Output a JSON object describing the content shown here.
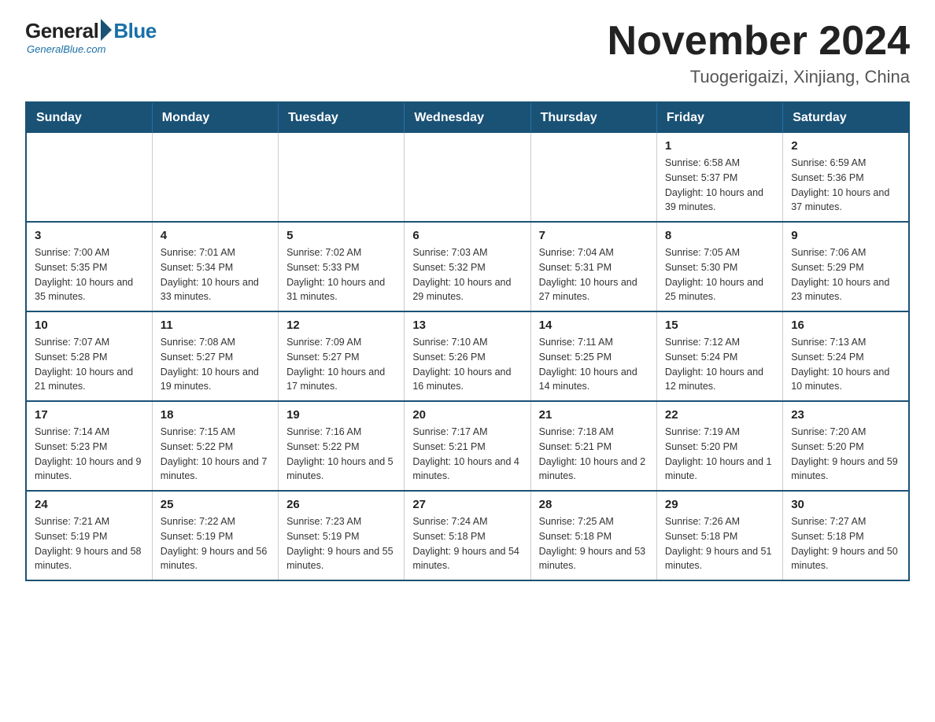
{
  "logo": {
    "general": "General",
    "blue": "Blue",
    "subtitle": "GeneralBlue.com"
  },
  "title": "November 2024",
  "location": "Tuogerigaizi, Xinjiang, China",
  "weekdays": [
    "Sunday",
    "Monday",
    "Tuesday",
    "Wednesday",
    "Thursday",
    "Friday",
    "Saturday"
  ],
  "weeks": [
    [
      {
        "day": "",
        "info": ""
      },
      {
        "day": "",
        "info": ""
      },
      {
        "day": "",
        "info": ""
      },
      {
        "day": "",
        "info": ""
      },
      {
        "day": "",
        "info": ""
      },
      {
        "day": "1",
        "info": "Sunrise: 6:58 AM\nSunset: 5:37 PM\nDaylight: 10 hours and 39 minutes."
      },
      {
        "day": "2",
        "info": "Sunrise: 6:59 AM\nSunset: 5:36 PM\nDaylight: 10 hours and 37 minutes."
      }
    ],
    [
      {
        "day": "3",
        "info": "Sunrise: 7:00 AM\nSunset: 5:35 PM\nDaylight: 10 hours and 35 minutes."
      },
      {
        "day": "4",
        "info": "Sunrise: 7:01 AM\nSunset: 5:34 PM\nDaylight: 10 hours and 33 minutes."
      },
      {
        "day": "5",
        "info": "Sunrise: 7:02 AM\nSunset: 5:33 PM\nDaylight: 10 hours and 31 minutes."
      },
      {
        "day": "6",
        "info": "Sunrise: 7:03 AM\nSunset: 5:32 PM\nDaylight: 10 hours and 29 minutes."
      },
      {
        "day": "7",
        "info": "Sunrise: 7:04 AM\nSunset: 5:31 PM\nDaylight: 10 hours and 27 minutes."
      },
      {
        "day": "8",
        "info": "Sunrise: 7:05 AM\nSunset: 5:30 PM\nDaylight: 10 hours and 25 minutes."
      },
      {
        "day": "9",
        "info": "Sunrise: 7:06 AM\nSunset: 5:29 PM\nDaylight: 10 hours and 23 minutes."
      }
    ],
    [
      {
        "day": "10",
        "info": "Sunrise: 7:07 AM\nSunset: 5:28 PM\nDaylight: 10 hours and 21 minutes."
      },
      {
        "day": "11",
        "info": "Sunrise: 7:08 AM\nSunset: 5:27 PM\nDaylight: 10 hours and 19 minutes."
      },
      {
        "day": "12",
        "info": "Sunrise: 7:09 AM\nSunset: 5:27 PM\nDaylight: 10 hours and 17 minutes."
      },
      {
        "day": "13",
        "info": "Sunrise: 7:10 AM\nSunset: 5:26 PM\nDaylight: 10 hours and 16 minutes."
      },
      {
        "day": "14",
        "info": "Sunrise: 7:11 AM\nSunset: 5:25 PM\nDaylight: 10 hours and 14 minutes."
      },
      {
        "day": "15",
        "info": "Sunrise: 7:12 AM\nSunset: 5:24 PM\nDaylight: 10 hours and 12 minutes."
      },
      {
        "day": "16",
        "info": "Sunrise: 7:13 AM\nSunset: 5:24 PM\nDaylight: 10 hours and 10 minutes."
      }
    ],
    [
      {
        "day": "17",
        "info": "Sunrise: 7:14 AM\nSunset: 5:23 PM\nDaylight: 10 hours and 9 minutes."
      },
      {
        "day": "18",
        "info": "Sunrise: 7:15 AM\nSunset: 5:22 PM\nDaylight: 10 hours and 7 minutes."
      },
      {
        "day": "19",
        "info": "Sunrise: 7:16 AM\nSunset: 5:22 PM\nDaylight: 10 hours and 5 minutes."
      },
      {
        "day": "20",
        "info": "Sunrise: 7:17 AM\nSunset: 5:21 PM\nDaylight: 10 hours and 4 minutes."
      },
      {
        "day": "21",
        "info": "Sunrise: 7:18 AM\nSunset: 5:21 PM\nDaylight: 10 hours and 2 minutes."
      },
      {
        "day": "22",
        "info": "Sunrise: 7:19 AM\nSunset: 5:20 PM\nDaylight: 10 hours and 1 minute."
      },
      {
        "day": "23",
        "info": "Sunrise: 7:20 AM\nSunset: 5:20 PM\nDaylight: 9 hours and 59 minutes."
      }
    ],
    [
      {
        "day": "24",
        "info": "Sunrise: 7:21 AM\nSunset: 5:19 PM\nDaylight: 9 hours and 58 minutes."
      },
      {
        "day": "25",
        "info": "Sunrise: 7:22 AM\nSunset: 5:19 PM\nDaylight: 9 hours and 56 minutes."
      },
      {
        "day": "26",
        "info": "Sunrise: 7:23 AM\nSunset: 5:19 PM\nDaylight: 9 hours and 55 minutes."
      },
      {
        "day": "27",
        "info": "Sunrise: 7:24 AM\nSunset: 5:18 PM\nDaylight: 9 hours and 54 minutes."
      },
      {
        "day": "28",
        "info": "Sunrise: 7:25 AM\nSunset: 5:18 PM\nDaylight: 9 hours and 53 minutes."
      },
      {
        "day": "29",
        "info": "Sunrise: 7:26 AM\nSunset: 5:18 PM\nDaylight: 9 hours and 51 minutes."
      },
      {
        "day": "30",
        "info": "Sunrise: 7:27 AM\nSunset: 5:18 PM\nDaylight: 9 hours and 50 minutes."
      }
    ]
  ]
}
